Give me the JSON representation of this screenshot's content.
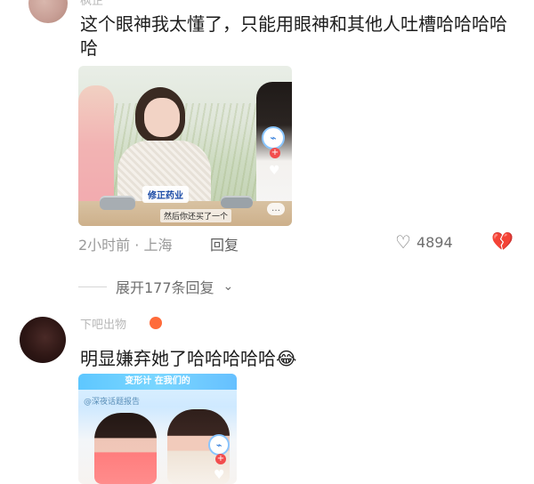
{
  "comments": [
    {
      "username": "枫芷",
      "text": "这个眼神我太懂了，只能用眼神和其他人吐槽哈哈哈哈哈",
      "image": {
        "brand": "修正药业",
        "subtitle": "然后你还买了一个",
        "badge_icon": "doll-icon",
        "badge_plus": "+",
        "heart": "♥",
        "more": "…"
      },
      "time_location": "2小时前 · 上海",
      "reply_label": "回复",
      "likes": "4894",
      "like_icon": "heart-outline-icon",
      "dislike_icon": "broken-heart-icon"
    },
    {
      "username": "下吧出物",
      "text": "明显嫌弃她了哈哈哈哈哈",
      "emoji": "😂",
      "image": {
        "top_banner": "变形计 在我们的",
        "small_label": "@深夜话题报告",
        "badge_plus": "+",
        "heart": "♥",
        "badge_icon": "doll-icon"
      }
    }
  ],
  "expand_replies": "展开177条回复",
  "colors": {
    "text_primary": "#1d1d1d",
    "text_secondary": "#9a9a9a",
    "action_text": "#5e5e5e",
    "icon": "#6e6e6e"
  }
}
